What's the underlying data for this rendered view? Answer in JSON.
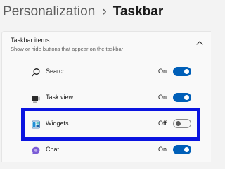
{
  "breadcrumb": {
    "parent": "Personalization",
    "separator": "›",
    "current": "Taskbar"
  },
  "section": {
    "title": "Taskbar items",
    "subtitle": "Show or hide buttons that appear on the taskbar",
    "expanded": true
  },
  "items": [
    {
      "label": "Search",
      "state": "On",
      "icon": "search-icon",
      "enabled": true
    },
    {
      "label": "Task view",
      "state": "On",
      "icon": "task-view-icon",
      "enabled": true
    },
    {
      "label": "Widgets",
      "state": "Off",
      "icon": "widgets-icon",
      "enabled": false
    },
    {
      "label": "Chat",
      "state": "On",
      "icon": "chat-icon",
      "enabled": true
    }
  ],
  "colors": {
    "accent": "#005fb8",
    "highlight": "#0a14e0",
    "background": "#f3f3f3",
    "panel": "#f9f9f9"
  }
}
